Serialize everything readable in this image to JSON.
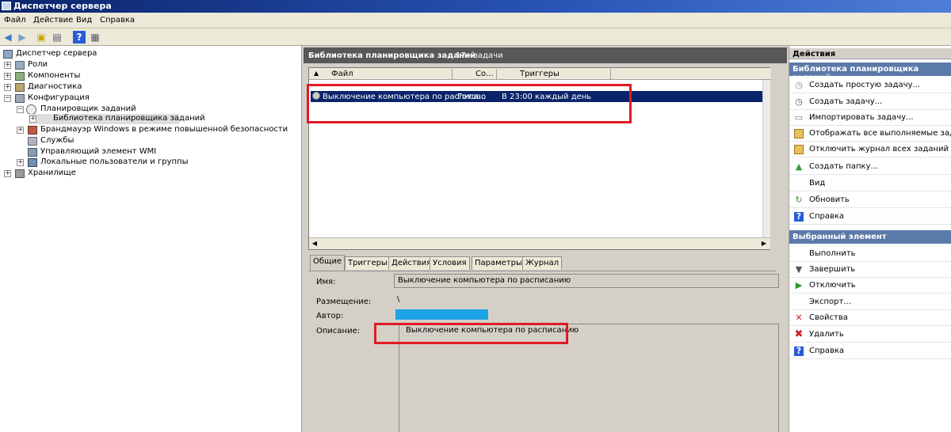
{
  "window": {
    "title": "Диспетчер сервера"
  },
  "menu": [
    "Файл",
    "Действие",
    "Вид",
    "Справка"
  ],
  "toolbar": {
    "icons": [
      "back-icon",
      "forward-icon",
      "up-folder-icon",
      "show-hide-tree-icon",
      "help-icon",
      "properties-icon"
    ]
  },
  "tree": {
    "items": [
      {
        "label": "Диспетчер сервера",
        "level": 0,
        "expander": ""
      },
      {
        "label": "Роли",
        "level": 1,
        "expander": "+"
      },
      {
        "label": "Компоненты",
        "level": 1,
        "expander": "+"
      },
      {
        "label": "Диагностика",
        "level": 1,
        "expander": "+"
      },
      {
        "label": "Конфигурация",
        "level": 1,
        "expander": "−"
      },
      {
        "label": "Планировщик заданий",
        "level": 2,
        "expander": "−"
      },
      {
        "label": "Библиотека планировщика заданий",
        "level": 3,
        "expander": "+"
      },
      {
        "label": "Брандмауэр Windows в режиме повышенной безопасности",
        "level": 2,
        "expander": "+"
      },
      {
        "label": "Службы",
        "level": 2,
        "expander": ""
      },
      {
        "label": "Управляющий элемент WMI",
        "level": 2,
        "expander": ""
      },
      {
        "label": "Локальные пользователи и группы",
        "level": 2,
        "expander": "+"
      },
      {
        "label": "Хранилище",
        "level": 1,
        "expander": "+"
      }
    ]
  },
  "center": {
    "header": "Библиотека планировщика заданий",
    "count": "17 - задачи",
    "columns": [
      "Файл",
      "Со...",
      "Триггеры"
    ],
    "tasks": [
      {
        "name": "Выключение компьютера по расписа...",
        "status": "Готово",
        "trigger": "В 23:00 каждый день"
      }
    ],
    "tabs": [
      "Общие",
      "Триггеры",
      "Действия",
      "Условия",
      "Параметры",
      "Журнал"
    ],
    "details": {
      "name_label": "Имя:",
      "name_value": "Выключение компьютера по расписанию",
      "location_label": "Размещение:",
      "location_value": "\\",
      "author_label": "Автор:",
      "author_value": "",
      "description_label": "Описание:",
      "description_value": "Выключение компьютера по расписанию"
    }
  },
  "actions": {
    "title": "Действия",
    "section1_title": "Библиотека планировщика заданий",
    "section1_items": [
      {
        "label": "Создать простую задачу...",
        "icon": "clock-wand-icon"
      },
      {
        "label": "Создать задачу...",
        "icon": "clock-icon"
      },
      {
        "label": "Импортировать задачу...",
        "icon": "import-icon"
      },
      {
        "label": "Отображать все выполняемые задачи",
        "icon": "folder-icon"
      },
      {
        "label": "Отключить журнал всех заданий",
        "icon": "folder-icon"
      },
      {
        "label": "Создать папку...",
        "icon": "new-folder-icon"
      },
      {
        "label": "Вид",
        "icon": ""
      },
      {
        "label": "Обновить",
        "icon": "refresh-icon"
      },
      {
        "label": "Справка",
        "icon": "help-icon"
      }
    ],
    "section2_title": "Выбранный элемент",
    "section2_items": [
      {
        "label": "Выполнить",
        "icon": ""
      },
      {
        "label": "Завершить",
        "icon": "stop-arrow-icon"
      },
      {
        "label": "Отключить",
        "icon": "disable-arrow-icon"
      },
      {
        "label": "Экспорт...",
        "icon": ""
      },
      {
        "label": "Свойства",
        "icon": "properties-x-icon"
      },
      {
        "label": "Удалить",
        "icon": "delete-icon"
      },
      {
        "label": "Справка",
        "icon": "help-icon"
      }
    ]
  },
  "colors": {
    "author_highlight": "#1aa3e6",
    "annotation_red": "#e01b24",
    "selection": "#0a246a"
  }
}
